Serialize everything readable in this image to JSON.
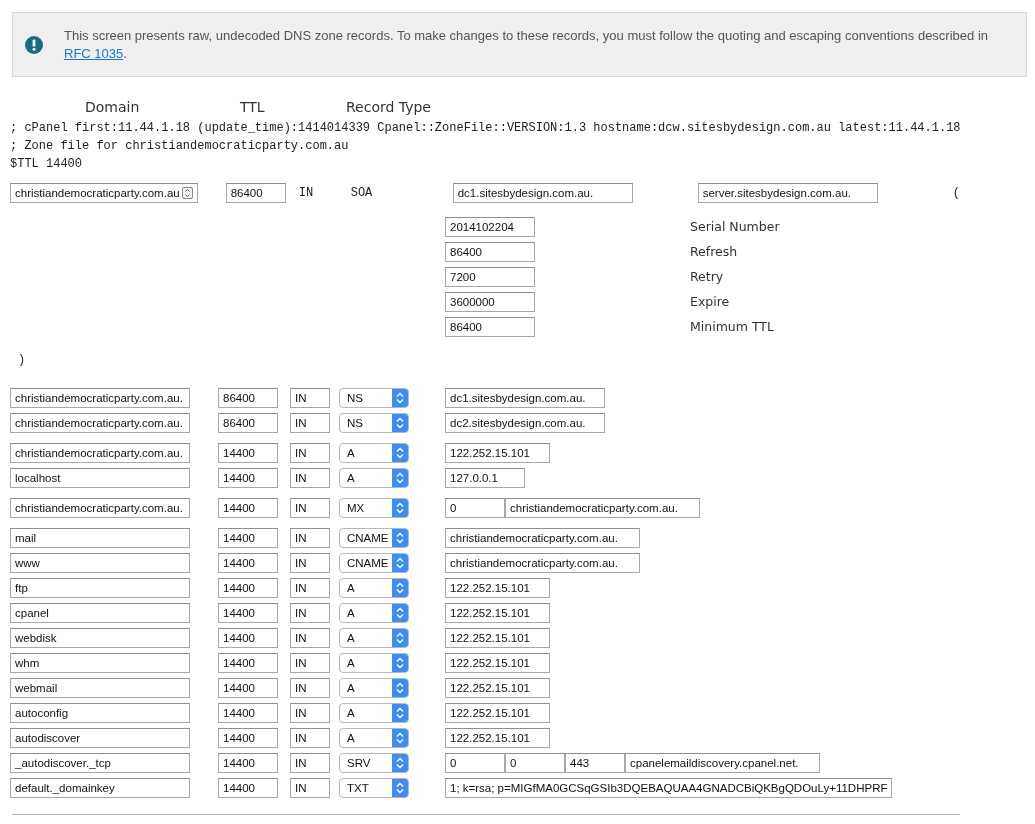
{
  "notice": {
    "text": "This screen presents raw, undecoded DNS zone records. To make changes to these records, you must follow the quoting and escaping conventions described in",
    "link": "RFC 1035",
    "text_after": "."
  },
  "columns": [
    "Domain",
    "TTL",
    "Record Type"
  ],
  "zone_header": [
    "; cPanel first:11.44.1.18 (update_time):1414014339 Cpanel::ZoneFile::VERSION:1.3 hostname:dcw.sitesbydesign.com.au latest:11.44.1.18",
    "; Zone file for christiandemocraticparty.com.au",
    "$TTL 14400"
  ],
  "soa": {
    "name": "christiandemocraticparty.com.au",
    "ttl": "86400",
    "class": "IN",
    "type": "SOA",
    "primary_ns": "dc1.sitesbydesign.com.au.",
    "contact": "server.sitesbydesign.com.au.",
    "open_paren": "(",
    "timers": [
      {
        "value": "2014102204",
        "label": "Serial Number"
      },
      {
        "value": "86400",
        "label": "Refresh"
      },
      {
        "value": "7200",
        "label": "Retry"
      },
      {
        "value": "3600000",
        "label": "Expire"
      },
      {
        "value": "86400",
        "label": "Minimum TTL"
      }
    ],
    "close_paren": ")"
  },
  "record_groups": [
    {
      "records": [
        {
          "name": "christiandemocraticparty.com.au.",
          "ttl": "86400",
          "class": "IN",
          "type": "NS",
          "data": [
            "dc1.sitesbydesign.com.au."
          ]
        },
        {
          "name": "christiandemocraticparty.com.au.",
          "ttl": "86400",
          "class": "IN",
          "type": "NS",
          "data": [
            "dc2.sitesbydesign.com.au."
          ]
        }
      ]
    },
    {
      "records": [
        {
          "name": "christiandemocraticparty.com.au.",
          "ttl": "14400",
          "class": "IN",
          "type": "A",
          "data": [
            "122.252.15.101"
          ]
        },
        {
          "name": "localhost",
          "ttl": "14400",
          "class": "IN",
          "type": "A",
          "data": [
            "127.0.0.1"
          ]
        }
      ]
    },
    {
      "records": [
        {
          "name": "christiandemocraticparty.com.au.",
          "ttl": "14400",
          "class": "IN",
          "type": "MX",
          "data": [
            "0",
            "christiandemocraticparty.com.au."
          ]
        }
      ]
    },
    {
      "records": [
        {
          "name": "mail",
          "ttl": "14400",
          "class": "IN",
          "type": "CNAME",
          "data": [
            "christiandemocraticparty.com.au."
          ]
        },
        {
          "name": "www",
          "ttl": "14400",
          "class": "IN",
          "type": "CNAME",
          "data": [
            "christiandemocraticparty.com.au."
          ]
        },
        {
          "name": "ftp",
          "ttl": "14400",
          "class": "IN",
          "type": "A",
          "data": [
            "122.252.15.101"
          ]
        },
        {
          "name": "cpanel",
          "ttl": "14400",
          "class": "IN",
          "type": "A",
          "data": [
            "122.252.15.101"
          ]
        },
        {
          "name": "webdisk",
          "ttl": "14400",
          "class": "IN",
          "type": "A",
          "data": [
            "122.252.15.101"
          ]
        },
        {
          "name": "whm",
          "ttl": "14400",
          "class": "IN",
          "type": "A",
          "data": [
            "122.252.15.101"
          ]
        },
        {
          "name": "webmail",
          "ttl": "14400",
          "class": "IN",
          "type": "A",
          "data": [
            "122.252.15.101"
          ]
        },
        {
          "name": "autoconfig",
          "ttl": "14400",
          "class": "IN",
          "type": "A",
          "data": [
            "122.252.15.101"
          ]
        },
        {
          "name": "autodiscover",
          "ttl": "14400",
          "class": "IN",
          "type": "A",
          "data": [
            "122.252.15.101"
          ]
        },
        {
          "name": "_autodiscover._tcp",
          "ttl": "14400",
          "class": "IN",
          "type": "SRV",
          "data": [
            "0",
            "0",
            "443",
            "cpanelemaildiscovery.cpanel.net."
          ]
        },
        {
          "name": "default._domainkey",
          "ttl": "14400",
          "class": "IN",
          "type": "TXT",
          "data": [
            "1; k=rsa; p=MIGfMA0GCSqGSIb3DQEBAQUAA4GNADCBiQKBgQDOuLy+11DHPRF"
          ]
        }
      ]
    }
  ]
}
